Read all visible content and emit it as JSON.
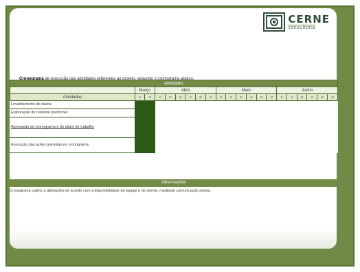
{
  "logo": {
    "name": "CERNE",
    "tagline": "consultoria"
  },
  "intro": {
    "bold": "Cronograma",
    "text": " de execução das atividades referentes ao projeto, segundo o cronograma abaixo."
  },
  "schedule": {
    "title": "Atividades",
    "activity_header": "Atividades",
    "months": [
      "Março",
      "Abril",
      "Maio",
      "Junho"
    ],
    "weeks": {
      "marco": [
        "1ª",
        "2ª"
      ],
      "abril": [
        "1ª",
        "2ª",
        "3ª",
        "4ª",
        "5ª",
        "6ª"
      ],
      "maio": [
        "1ª",
        "2ª",
        "3ª",
        "4ª",
        "5ª",
        "6ª"
      ],
      "junho": [
        "1ª",
        "2ª",
        "3ª",
        "4ª",
        "5ª",
        "6ª"
      ]
    },
    "activities": [
      "Levantamento de dados",
      "Elaboração do relatório preliminar",
      "Aprovação do cronograma e do plano de trabalho",
      "Execução das ações previstas no cronograma"
    ]
  },
  "observations": {
    "title": "Observações",
    "text": "Cronograma sujeito a alterações de acordo com a disponibilidade da equipe e do cliente, mediante comunicação prévia."
  },
  "colors": {
    "frame": "#6f8b45",
    "accent": "#728b47",
    "fill": "#2c5a14"
  }
}
